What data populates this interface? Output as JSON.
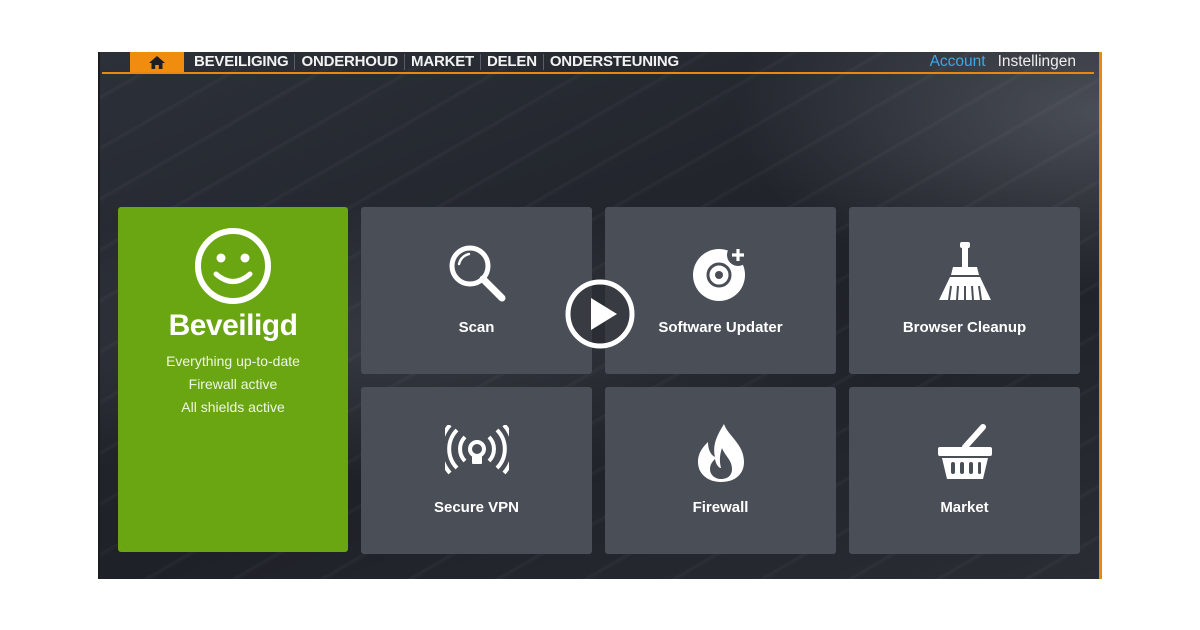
{
  "nav": {
    "home_icon": "home-icon",
    "items": [
      {
        "label": "BEVEILIGING"
      },
      {
        "label": "ONDERHOUD"
      },
      {
        "label": "MARKET"
      },
      {
        "label": "DELEN"
      },
      {
        "label": "ONDERSTEUNING"
      }
    ],
    "account": "Account",
    "settings": "Instellingen"
  },
  "status": {
    "icon": "smiley-icon",
    "title": "Beveiligd",
    "lines": [
      "Everything up-to-date",
      "Firewall active",
      "All shields active"
    ]
  },
  "tiles": [
    {
      "label": "Scan",
      "icon": "magnifier-icon"
    },
    {
      "label": "Software Updater",
      "icon": "disc-plus-icon"
    },
    {
      "label": "Browser Cleanup",
      "icon": "broom-icon"
    },
    {
      "label": "Secure VPN",
      "icon": "vpn-signal-icon"
    },
    {
      "label": "Firewall",
      "icon": "flame-icon"
    },
    {
      "label": "Market",
      "icon": "basket-icon"
    }
  ],
  "video": {
    "icon": "play-icon"
  },
  "colors": {
    "accent": "#f08c0e",
    "status_green": "#6aa512",
    "tile": "#4a4e56",
    "account_link": "#3ea8e6"
  }
}
